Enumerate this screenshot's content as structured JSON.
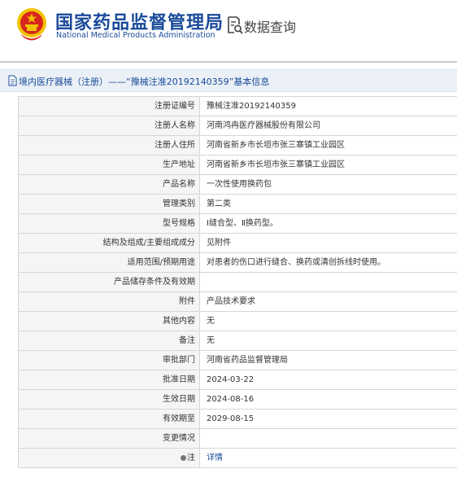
{
  "header": {
    "org_cn": "国家药品监督管理局",
    "org_en": "National Medical Products Administration",
    "query_title": "数据查询"
  },
  "info": {
    "title": "境内医疗器械（注册）——“豫械注准20192140359”基本信息"
  },
  "rows": [
    {
      "label": "注册证编号",
      "value": "豫械注准20192140359"
    },
    {
      "label": "注册人名称",
      "value": "河南鸿冉医疗器械股份有限公司"
    },
    {
      "label": "注册人住所",
      "value": "河南省新乡市长垣市张三寨镇工业园区"
    },
    {
      "label": "生产地址",
      "value": "河南省新乡市长垣市张三寨镇工业园区"
    },
    {
      "label": "产品名称",
      "value": "一次性使用换药包"
    },
    {
      "label": "管理类别",
      "value": "第二类"
    },
    {
      "label": "型号规格",
      "value": "Ⅰ缝合型、Ⅱ换药型。"
    },
    {
      "label": "结构及组成/主要组成成分",
      "value": "见附件"
    },
    {
      "label": "适用范围/预期用途",
      "value": "对患者的伤口进行缝合、换药或清创拆线时使用。"
    },
    {
      "label": "产品储存条件及有效期",
      "value": ""
    },
    {
      "label": "附件",
      "value": "产品技术要求"
    },
    {
      "label": "其他内容",
      "value": "无"
    },
    {
      "label": "备注",
      "value": "无"
    },
    {
      "label": "审批部门",
      "value": "河南省药品监督管理局"
    },
    {
      "label": "批准日期",
      "value": "2024-03-22"
    },
    {
      "label": "生效日期",
      "value": "2024-08-16"
    },
    {
      "label": "有效期至",
      "value": "2029-08-15"
    },
    {
      "label": "变更情况",
      "value": ""
    },
    {
      "label": "注",
      "value": "详情"
    }
  ],
  "colors": {
    "brand_blue": "#1a4a9a",
    "emblem_red": "#d7261e",
    "emblem_gold": "#f2c200",
    "label_bg": "#f5f5f5",
    "info_bar_bg": "#eaf0f6"
  },
  "icons": {
    "emblem": "national-emblem-icon",
    "query": "data-query-icon",
    "doc": "document-icon",
    "tip": "tip-dot-icon"
  }
}
